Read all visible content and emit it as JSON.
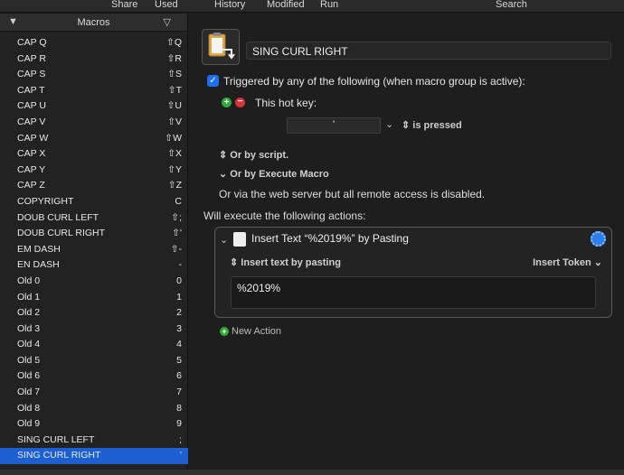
{
  "toolbar": {
    "share": "Share",
    "used": "Used",
    "history": "History",
    "modified": "Modified",
    "run": "Run",
    "search": "Search"
  },
  "macros_panel": {
    "title": "Macros",
    "items": [
      {
        "name": "CAP Q",
        "key": "⇧Q"
      },
      {
        "name": "CAP R",
        "key": "⇧R"
      },
      {
        "name": "CAP S",
        "key": "⇧S"
      },
      {
        "name": "CAP T",
        "key": "⇧T"
      },
      {
        "name": "CAP U",
        "key": "⇧U"
      },
      {
        "name": "CAP V",
        "key": "⇧V"
      },
      {
        "name": "CAP W",
        "key": "⇧W"
      },
      {
        "name": "CAP X",
        "key": "⇧X"
      },
      {
        "name": "CAP Y",
        "key": "⇧Y"
      },
      {
        "name": "CAP Z",
        "key": "⇧Z"
      },
      {
        "name": "COPYRIGHT",
        "key": "C"
      },
      {
        "name": "DOUB CURL LEFT",
        "key": "⇧;"
      },
      {
        "name": "DOUB CURL RIGHT",
        "key": "⇧'"
      },
      {
        "name": "EM DASH",
        "key": "⇧-"
      },
      {
        "name": "EN DASH",
        "key": "-"
      },
      {
        "name": "Old 0",
        "key": "0"
      },
      {
        "name": "Old 1",
        "key": "1"
      },
      {
        "name": "Old 2",
        "key": "2"
      },
      {
        "name": "Old 3",
        "key": "3"
      },
      {
        "name": "Old 4",
        "key": "4"
      },
      {
        "name": "Old 5",
        "key": "5"
      },
      {
        "name": "Old 6",
        "key": "6"
      },
      {
        "name": "Old 7",
        "key": "7"
      },
      {
        "name": "Old 8",
        "key": "8"
      },
      {
        "name": "Old 9",
        "key": "9"
      },
      {
        "name": "SING CURL LEFT",
        "key": ";"
      },
      {
        "name": "SING CURL RIGHT",
        "key": "'"
      }
    ],
    "selected_index": 26
  },
  "editor": {
    "macro_name": "SING CURL RIGHT",
    "trigger_text": "Triggered by any of the following (when macro group is active):",
    "hotkey_label": "This hot key:",
    "hotkey_value": "'",
    "hotkey_condition": "is pressed",
    "or_by_script": "Or by script.",
    "or_by_execute_macro": "Or by Execute Macro",
    "web_server_text": "Or via the web server but all remote access is disabled.",
    "will_execute": "Will execute the following actions:",
    "action": {
      "title": "Insert Text “%2019%” by Pasting",
      "mode": "Insert text by pasting",
      "token_menu": "Insert Token",
      "text_value": "%2019%"
    },
    "new_action": "New Action"
  },
  "colors": {
    "selection": "#1b5fd1",
    "checkbox": "#1e6ef0",
    "add": "#2eaa3a",
    "remove": "#d8333a"
  }
}
